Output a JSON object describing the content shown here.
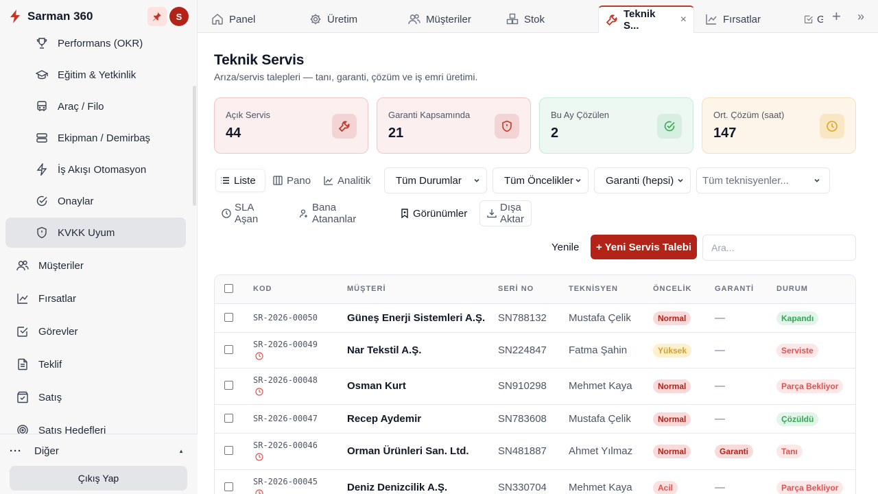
{
  "brand": {
    "name": "Sarman 360",
    "avatar_initial": "S"
  },
  "sidebar": {
    "items": [
      {
        "label": "Performans (OKR)",
        "icon": "trophy-icon"
      },
      {
        "label": "Eğitim & Yetkinlik",
        "icon": "graduation-cap-icon"
      },
      {
        "label": "Araç / Filo",
        "icon": "bus-icon"
      },
      {
        "label": "Ekipman / Demirbaş",
        "icon": "server-icon"
      },
      {
        "label": "İş Akışı Otomasyon",
        "icon": "zap-icon"
      },
      {
        "label": "Onaylar",
        "icon": "check-circle-icon"
      },
      {
        "label": "KVKK Uyum",
        "icon": "shield-icon"
      },
      {
        "label": "Müşteriler",
        "icon": "users-icon"
      },
      {
        "label": "Fırsatlar",
        "icon": "trending-up-icon"
      },
      {
        "label": "Görevler",
        "icon": "check-square-icon"
      },
      {
        "label": "Teklif",
        "icon": "file-text-icon"
      },
      {
        "label": "Satış",
        "icon": "shopping-bag-icon"
      },
      {
        "label": "Satış Hedefleri",
        "icon": "target-icon"
      }
    ],
    "more_label": "Diğer",
    "logout_label": "Çıkış Yap"
  },
  "tabs": [
    {
      "label": "Panel",
      "icon": "home-icon"
    },
    {
      "label": "Üretim",
      "icon": "gear-icon"
    },
    {
      "label": "Müşteriler",
      "icon": "users-icon"
    },
    {
      "label": "Stok",
      "icon": "boxes-icon"
    },
    {
      "label": "Teknik S...",
      "icon": "wrench-icon",
      "active": true
    },
    {
      "label": "Fırsatlar",
      "icon": "trending-up-icon"
    },
    {
      "label": "G",
      "icon": "check-square-icon"
    }
  ],
  "page": {
    "title": "Teknik Servis",
    "subtitle": "Arıza/servis talepleri — tanı, garanti, çözüm ve iş emri üretimi."
  },
  "cards": [
    {
      "label": "Açık Servis",
      "value": "44",
      "icon": "wrench-icon",
      "bg": "#fbeff0",
      "border": "#f5c5c5",
      "icon_bg": "#f3d4d4",
      "icon_color": "#c0392b"
    },
    {
      "label": "Garanti Kapsamında",
      "value": "21",
      "icon": "shield-icon",
      "bg": "#fbeff0",
      "border": "#f5c5c5",
      "icon_bg": "#f3d4d4",
      "icon_color": "#c0392b"
    },
    {
      "label": "Bu Ay Çözülen",
      "value": "2",
      "icon": "check-circle-icon",
      "bg": "#eef8f2",
      "border": "#c8ead6",
      "icon_bg": "#d6efe0",
      "icon_color": "#34a853"
    },
    {
      "label": "Ort. Çözüm (saat)",
      "value": "147",
      "icon": "clock-icon",
      "bg": "#fdf5ea",
      "border": "#f5dfb8",
      "icon_bg": "#f9e6c2",
      "icon_color": "#e0a526"
    }
  ],
  "views": {
    "list": "Liste",
    "board": "Pano",
    "analytics": "Analitik"
  },
  "filters": {
    "status": "Tüm Durumlar",
    "priority": "Tüm Öncelikler",
    "warranty": "Garanti (hepsi)",
    "technician_placeholder": "Tüm teknisyenler..."
  },
  "actions": {
    "sla": "SLA Aşan",
    "mine": "Bana Atananlar",
    "views": "Görünümler",
    "export": "Dışa Aktar",
    "refresh": "Yenile",
    "new": "+ Yeni Servis Talebi",
    "search_placeholder": "Ara..."
  },
  "table": {
    "columns": [
      "KOD",
      "MÜŞTERİ",
      "SERİ NO",
      "TEKNİSYEN",
      "ÖNCELİK",
      "GARANTİ",
      "DURUM"
    ],
    "rows": [
      {
        "code": "SR-2026-00050",
        "customer": "Güneş Enerji Sistemleri A.Ş.",
        "serial": "SN788132",
        "technician": "Mustafa Çelik",
        "priority": "Normal",
        "warranty": "—",
        "status": "Kapandı",
        "overdue": false
      },
      {
        "code": "SR-2026-00049",
        "customer": "Nar Tekstil A.Ş.",
        "serial": "SN224847",
        "technician": "Fatma Şahin",
        "priority": "Yüksek",
        "warranty": "—",
        "status": "Serviste",
        "overdue": true
      },
      {
        "code": "SR-2026-00048",
        "customer": "Osman Kurt",
        "serial": "SN910298",
        "technician": "Mehmet Kaya",
        "priority": "Normal",
        "warranty": "—",
        "status": "Parça Bekliyor",
        "overdue": true
      },
      {
        "code": "SR-2026-00047",
        "customer": "Recep Aydemir",
        "serial": "SN783608",
        "technician": "Mustafa Çelik",
        "priority": "Normal",
        "warranty": "—",
        "status": "Çözüldü",
        "overdue": false
      },
      {
        "code": "SR-2026-00046",
        "customer": "Orman Ürünleri San. Ltd.",
        "serial": "SN481887",
        "technician": "Ahmet Yılmaz",
        "priority": "Normal",
        "warranty": "Garanti",
        "status": "Tanı",
        "overdue": true
      },
      {
        "code": "SR-2026-00045",
        "customer": "Deniz Denizcilik A.Ş.",
        "serial": "SN330704",
        "technician": "Mehmet Kaya",
        "priority": "Acil",
        "warranty": "—",
        "status": "Parça Bekliyor",
        "overdue": true
      }
    ]
  },
  "colors": {
    "accent": "#b42318",
    "priority": {
      "Normal": [
        "#f8dada",
        "#b42318"
      ],
      "Yüksek": [
        "#fdf0cc",
        "#d69e2e"
      ],
      "Acil": [
        "#fbe0e0",
        "#e05252"
      ]
    },
    "status": {
      "Kapandı": [
        "#e3f5ea",
        "#34a853"
      ],
      "Serviste": [
        "#fde7e7",
        "#e05252"
      ],
      "Parça Bekliyor": [
        "#fde7e7",
        "#e05252"
      ],
      "Çözüldü": [
        "#e3f5ea",
        "#34a853"
      ],
      "Tanı": [
        "#fde7e7",
        "#e05252"
      ]
    },
    "warranty": [
      "#f8dada",
      "#b42318"
    ]
  }
}
